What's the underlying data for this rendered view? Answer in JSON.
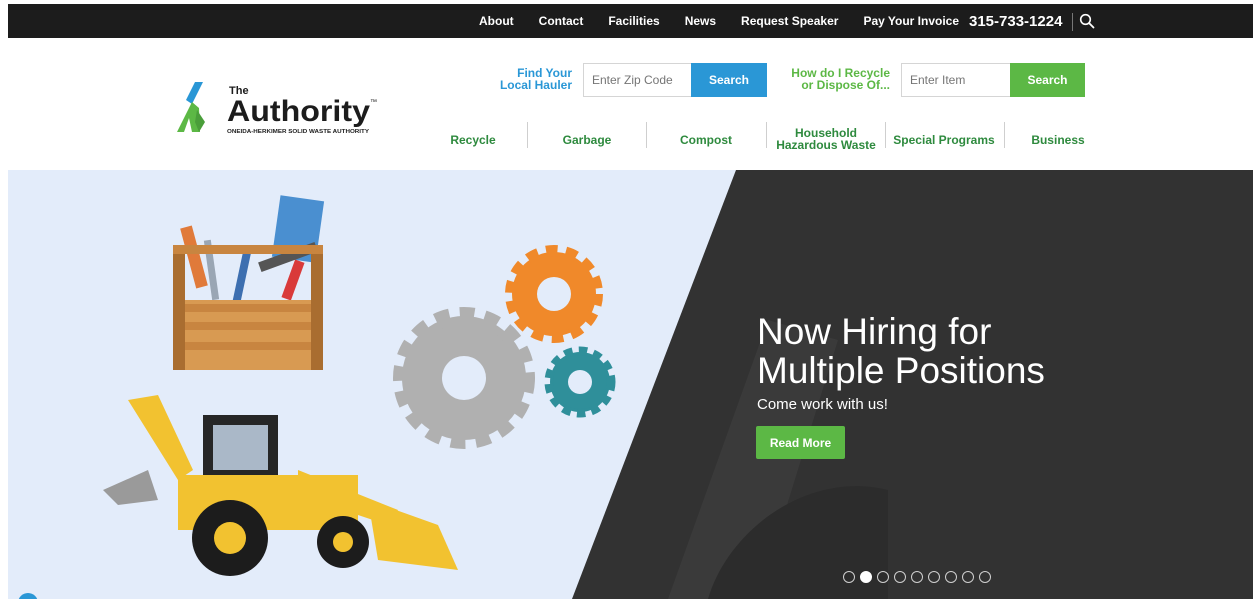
{
  "topbar": {
    "links": [
      "About",
      "Contact",
      "Facilities",
      "News",
      "Request Speaker",
      "Pay Your Invoice"
    ],
    "phone": "315-733-1224"
  },
  "logo": {
    "the": "The",
    "name": "Authority",
    "tm": "™",
    "tagline": "ONEIDA-HERKIMER SOLID WASTE AUTHORITY"
  },
  "hauler_finder": {
    "label_line1": "Find Your",
    "label_line2": "Local Hauler",
    "placeholder": "Enter Zip Code",
    "button": "Search"
  },
  "recycle_finder": {
    "label_line1": "How do I Recycle",
    "label_line2": "or Dispose Of...",
    "placeholder": "Enter Item",
    "button": "Search"
  },
  "main_nav": {
    "recycle": "Recycle",
    "garbage": "Garbage",
    "compost": "Compost",
    "household_line1": "Household",
    "household_line2": "Hazardous Waste",
    "special": "Special Programs",
    "business": "Business"
  },
  "hero": {
    "title_line1": "Now Hiring for",
    "title_line2": "Multiple Positions",
    "subtitle": "Come work with us!",
    "button": "Read More",
    "active_slide": 2,
    "total_slides": 9
  },
  "colors": {
    "blue": "#2a97d6",
    "green": "#5cb845",
    "nav_green": "#2e8a3e",
    "dark": "#1c1c1c",
    "hero_light": "#e3ecfa",
    "hero_dark": "#323232"
  }
}
